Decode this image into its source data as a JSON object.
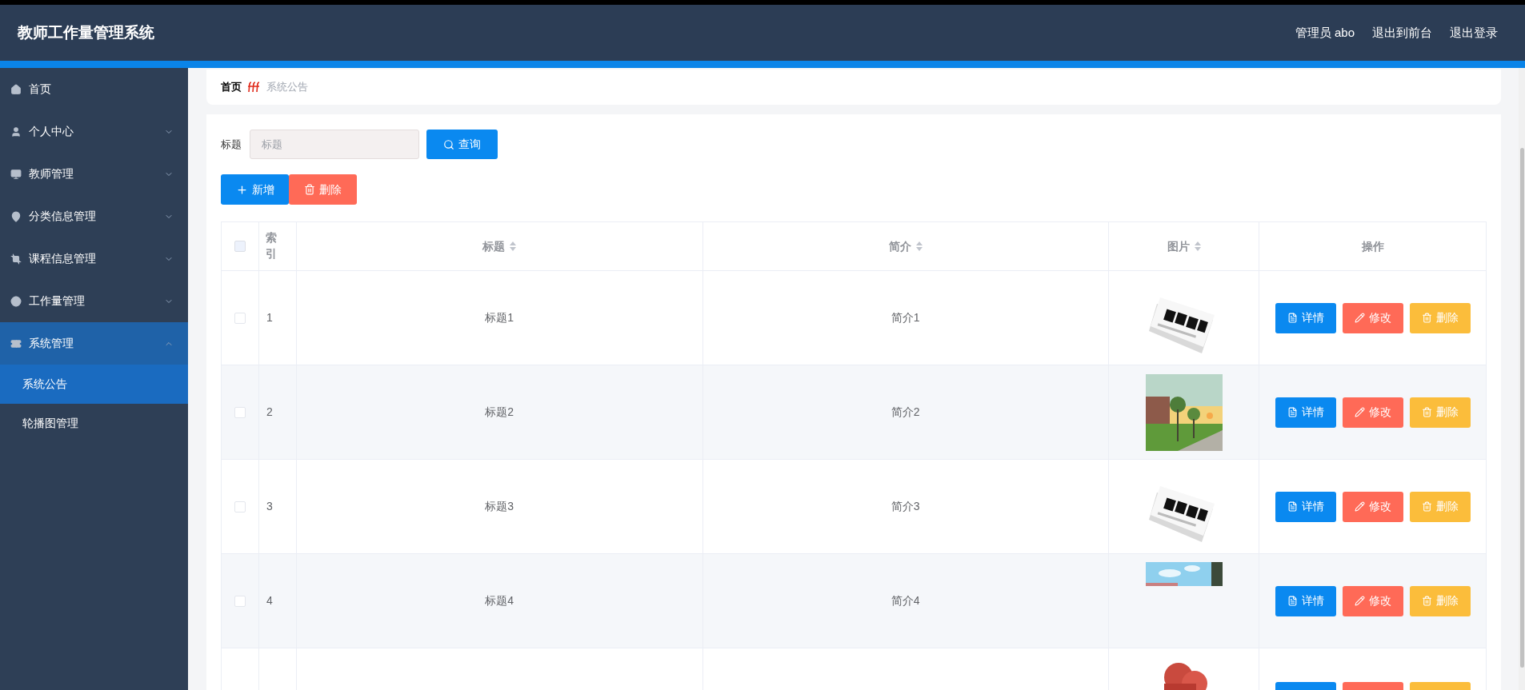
{
  "header": {
    "title": "教师工作量管理系统",
    "links": [
      "管理员 abo",
      "退出到前台",
      "退出登录"
    ]
  },
  "sidebar": {
    "items": [
      {
        "label": "首页",
        "expandable": false,
        "expanded": false
      },
      {
        "label": "个人中心",
        "expandable": true,
        "expanded": false
      },
      {
        "label": "教师管理",
        "expandable": true,
        "expanded": false
      },
      {
        "label": "分类信息管理",
        "expandable": true,
        "expanded": false
      },
      {
        "label": "课程信息管理",
        "expandable": true,
        "expanded": false
      },
      {
        "label": "工作量管理",
        "expandable": true,
        "expanded": false
      },
      {
        "label": "系统管理",
        "expandable": true,
        "expanded": true,
        "children": [
          {
            "label": "系统公告",
            "selected": true
          },
          {
            "label": "轮播图管理",
            "selected": false
          }
        ]
      }
    ]
  },
  "breadcrumb": {
    "home": "首页",
    "current": "系统公告"
  },
  "search": {
    "label": "标题",
    "placeholder": "标题",
    "button": "查询"
  },
  "toolbar": {
    "add": "新增",
    "delete": "删除"
  },
  "table": {
    "select_all_checked": false,
    "columns": [
      {
        "label": "索引",
        "sortable": false
      },
      {
        "label": "标题",
        "sortable": true
      },
      {
        "label": "简介",
        "sortable": true
      },
      {
        "label": "图片",
        "sortable": true
      },
      {
        "label": "操作",
        "sortable": false
      }
    ],
    "rows": [
      {
        "kind": "full",
        "checked": false,
        "index": "1",
        "title": "标题1",
        "intro": "简介1",
        "actions": [
          "详情",
          "修改",
          "删除"
        ]
      },
      {
        "kind": "full",
        "checked": false,
        "index": "2",
        "title": "标题2",
        "intro": "简介2",
        "actions": [
          "详情",
          "修改",
          "删除"
        ]
      },
      {
        "kind": "full",
        "checked": false,
        "index": "3",
        "title": "标题3",
        "intro": "简介3",
        "actions": [
          "详情",
          "修改",
          "删除"
        ]
      },
      {
        "kind": "full",
        "checked": false,
        "index": "4",
        "title": "标题4",
        "intro": "简介4",
        "actions": [
          "详情",
          "修改",
          "删除"
        ]
      },
      {
        "kind": "cut"
      }
    ]
  }
}
